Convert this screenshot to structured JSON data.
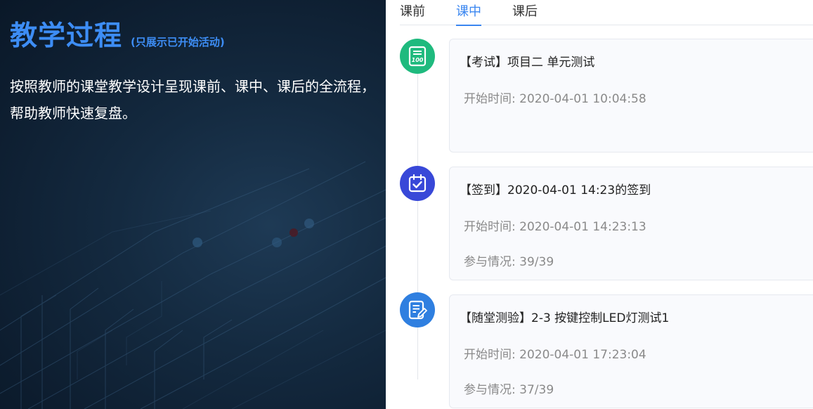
{
  "hero": {
    "title": "教学过程",
    "subtitle": "(只展示已开始活动)",
    "description": "按照教师的课堂教学设计呈现课前、课中、课后的全流程，帮助教师快速复盘。"
  },
  "tabs": [
    {
      "label": "课前",
      "active": false
    },
    {
      "label": "课中",
      "active": true
    },
    {
      "label": "课后",
      "active": false
    }
  ],
  "labels": {
    "start_time": "开始时间: ",
    "participation": "参与情况: "
  },
  "activities": [
    {
      "icon": "exam-icon",
      "color": "#1fba7e",
      "title": "【考试】项目二 单元测试",
      "start_time": "2020-04-01 10:04:58"
    },
    {
      "icon": "check-in-calendar-icon",
      "color": "#3848d8",
      "title": "【签到】2020-04-01 14:23的签到",
      "start_time": "2020-04-01 14:23:13",
      "participation": "39/39"
    },
    {
      "icon": "quiz-edit-icon",
      "color": "#2f7fe0",
      "title": "【随堂测验】2-3 按键控制LED灯测试1",
      "start_time": "2020-04-01 17:23:04",
      "participation": "37/39"
    }
  ]
}
